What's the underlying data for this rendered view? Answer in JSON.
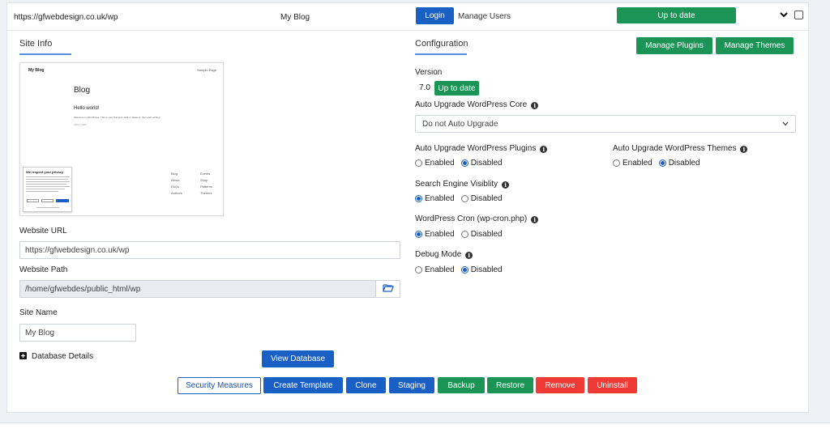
{
  "header": {
    "url": "https://gfwebdesign.co.uk/wp",
    "site_title": "My Blog",
    "login_label": "Login",
    "manage_users_label": "Manage Users",
    "status_label": "Up to date"
  },
  "site_info": {
    "section_title": "Site Info",
    "thumbnail": {
      "site_name": "My Blog",
      "nav_link": "Sample Page",
      "heading": "Blog",
      "post_title": "Hello world!",
      "post_excerpt": "Welcome to WordPress. This is your first post. Edit or delete it, then start writing!",
      "post_date": "March 2024",
      "privacy_title": "We respect your privacy",
      "links_col1": [
        "Blog",
        "About",
        "FAQs",
        "Authors"
      ],
      "links_col2": [
        "Events",
        "Shop",
        "Patterns",
        "Themes"
      ]
    },
    "website_url_label": "Website URL",
    "website_url_value": "https://gfwebdesign.co.uk/wp",
    "website_path_label": "Website Path",
    "website_path_value": "/home/gfwebdes/public_html/wp",
    "site_name_label": "Site Name",
    "site_name_value": "My Blog",
    "database_details_label": "Database Details",
    "view_database_label": "View Database"
  },
  "configuration": {
    "section_title": "Configuration",
    "manage_plugins_label": "Manage Plugins",
    "manage_themes_label": "Manage Themes",
    "version_label": "Version",
    "version_value": "7.0",
    "version_status_label": "Up to date",
    "auto_upgrade_core_label": "Auto Upgrade WordPress Core",
    "auto_upgrade_core_selected": "Do not Auto Upgrade",
    "auto_upgrade_plugins_label": "Auto Upgrade WordPress Plugins",
    "auto_upgrade_themes_label": "Auto Upgrade WordPress Themes",
    "search_engine_label": "Search Engine Visiblity",
    "cron_label": "WordPress Cron (wp-cron.php)",
    "debug_label": "Debug Mode",
    "enabled_label": "Enabled",
    "disabled_label": "Disabled",
    "settings": {
      "plugins": "disabled",
      "themes": "disabled",
      "search_engine": "enabled",
      "cron": "enabled",
      "debug": "disabled"
    }
  },
  "actions": {
    "security_measures": "Security Measures",
    "create_template": "Create Template",
    "clone": "Clone",
    "staging": "Staging",
    "backup": "Backup",
    "restore": "Restore",
    "remove": "Remove",
    "uninstall": "Uninstall"
  },
  "colors": {
    "blue": "#1a5fc4",
    "green": "#1b9456",
    "red": "#ef3b36"
  }
}
